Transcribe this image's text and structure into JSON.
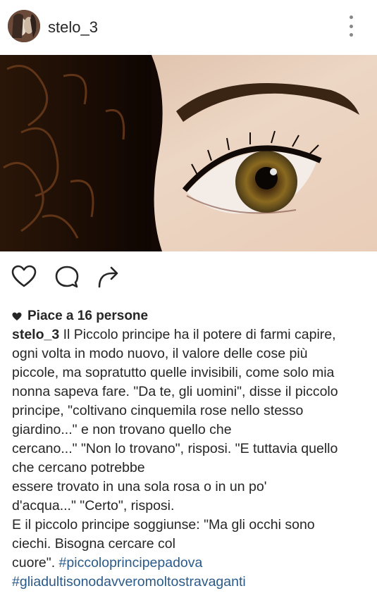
{
  "post": {
    "username": "stelo_3",
    "likes_text": "Piace a 16 persone",
    "caption_author": "stelo_3",
    "caption_lines": [
      " Il Piccolo principe ha il potere di farmi capire,",
      "ogni volta in modo nuovo, il valore delle cose più",
      "piccole, ma sopratutto quelle invisibili, come solo mia",
      "nonna sapeva fare. \"Da te, gli uomini\", disse il piccolo",
      "principe, \"coltivano cinquemila rose nello stesso",
      "giardino...\" e non trovano quello che",
      "cercano...\" \"Non lo trovano\", risposi. \"E tuttavia quello",
      "che cercano potrebbe",
      "essere trovato in una sola rosa o in un po'",
      "d'acqua...\" \"Certo\", risposi.",
      "E il piccolo principe soggiunse: \"Ma gli occhi sono",
      "ciechi. Bisogna cercare col"
    ],
    "caption_last_prefix": "cuore\". ",
    "hashtag_1": "#piccoloprincipepadova",
    "hashtag_2": "#gliadultisonodavveromoltostravaganti"
  },
  "icons": {
    "like": "heart-outline-icon",
    "comment": "comment-bubble-icon",
    "share": "share-arrow-icon",
    "more": "vertical-dots-icon"
  },
  "colors": {
    "hashtag": "#2a5a8a",
    "text": "#262626",
    "icon": "#262626"
  }
}
